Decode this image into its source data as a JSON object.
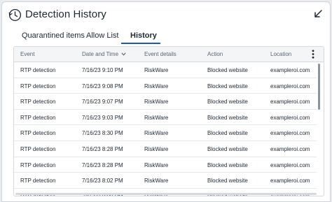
{
  "window": {
    "title": "Detection History",
    "icons": {
      "title": "history-clock-icon",
      "collapse": "collapse-arrow-icon"
    }
  },
  "tabs": [
    {
      "label": "Quarantined items",
      "active": false
    },
    {
      "label": "Allow List",
      "active": false
    },
    {
      "label": "History",
      "active": true
    }
  ],
  "table": {
    "columns": [
      "Event",
      "Date and Time",
      "Event details",
      "Action",
      "Location"
    ],
    "sort_column": "Date and Time",
    "sort_direction": "descending",
    "rows": [
      [
        "RTP detection",
        "7/16/23 9:10 PM",
        "RiskWare",
        "Blocked website",
        "exampleroi.com"
      ],
      [
        "RTP detection",
        "7/16/23 9:08 PM",
        "RiskWare",
        "Blocked website",
        "exampleroi.com"
      ],
      [
        "RTP detection",
        "7/16/23 9:07 PM",
        "RiskWare",
        "Blocked website",
        "exampleroi.com"
      ],
      [
        "RTP detection",
        "7/16/23 9:03 PM",
        "RiskWare",
        "Blocked website",
        "exampleroi.com"
      ],
      [
        "RTP detection",
        "7/16/23 8:30 PM",
        "RiskWare",
        "Blocked website",
        "exampleroi.com"
      ],
      [
        "RTP detection",
        "7/16/23 8:28 PM",
        "RiskWare",
        "Blocked website",
        "exampleroi.com"
      ],
      [
        "RTP detection",
        "7/16/23 8:28 PM",
        "RiskWare",
        "Blocked website",
        "exampleroi.com"
      ],
      [
        "RTP detection",
        "7/16/23 8:02 PM",
        "RiskWare",
        "Blocked website",
        "exampleroi.com"
      ],
      [
        "RTP detection",
        "7/16/23 8:00 PM",
        "RiskWare",
        "Blocked website",
        "exampleroi.com"
      ]
    ]
  },
  "colors": {
    "accent": "#1e56c8",
    "header_bg": "#f3f5f7",
    "border": "#d6dade"
  }
}
